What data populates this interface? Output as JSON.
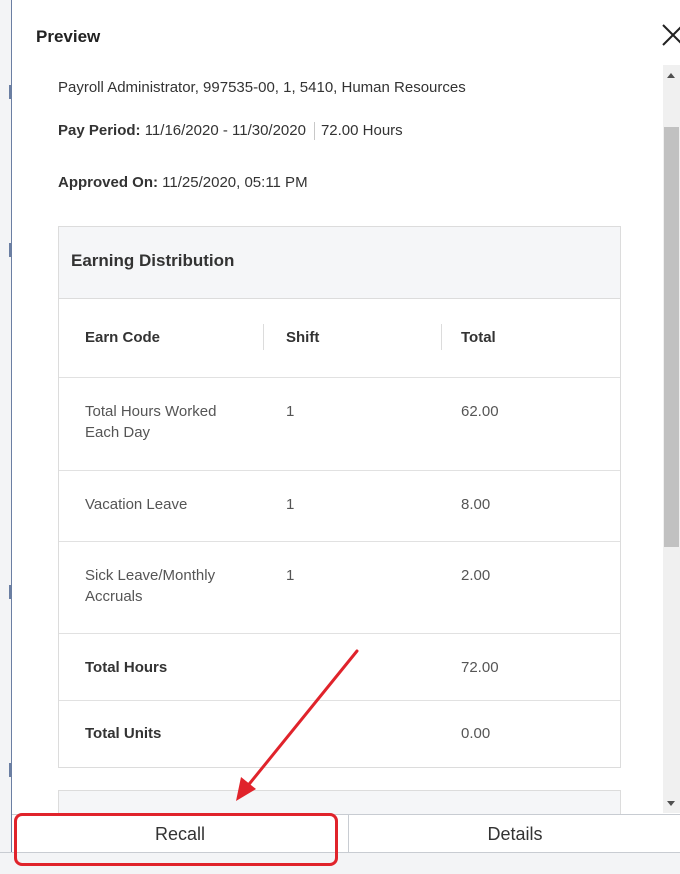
{
  "dialog": {
    "title": "Preview",
    "position_line": "Payroll Administrator, 997535-00, 1, 5410, Human Resources",
    "pay_period_label": "Pay Period:",
    "pay_period_value": "11/16/2020 - 11/30/2020",
    "hours_value": "72.00 Hours",
    "approved_label": "Approved On:",
    "approved_value": "11/25/2020, 05:11 PM"
  },
  "earning_distribution": {
    "title": "Earning Distribution",
    "columns": [
      "Earn Code",
      "Shift",
      "Total"
    ],
    "rows": [
      {
        "code_line1": "Total Hours Worked",
        "code_line2": "Each Day",
        "shift": "1",
        "total": "62.00"
      },
      {
        "code_line1": "Vacation Leave",
        "code_line2": "",
        "shift": "1",
        "total": "8.00"
      },
      {
        "code_line1": "Sick Leave/Monthly",
        "code_line2": "Accruals",
        "shift": "1",
        "total": "2.00"
      }
    ],
    "total_hours_label": "Total Hours",
    "total_hours_value": "72.00",
    "total_units_label": "Total Units",
    "total_units_value": "0.00"
  },
  "footer": {
    "recall_label": "Recall",
    "details_label": "Details"
  },
  "colors": {
    "highlight": "#e0232b",
    "border": "#dcdcdc",
    "header_bg": "#f5f6f8"
  },
  "icons": [
    "close-icon",
    "scroll-up-icon",
    "scroll-down-icon",
    "annotation-arrow"
  ]
}
